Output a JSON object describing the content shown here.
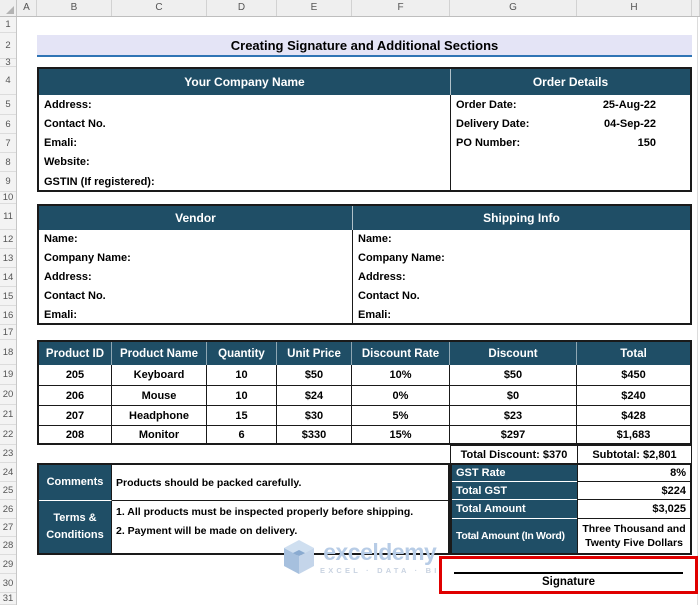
{
  "grid": {
    "columns": [
      "A",
      "B",
      "C",
      "D",
      "E",
      "F",
      "G",
      "H"
    ],
    "row_numbers": [
      "1",
      "2",
      "3",
      "4",
      "5",
      "6",
      "7",
      "8",
      "9",
      "10",
      "11",
      "12",
      "13",
      "14",
      "15",
      "16",
      "17",
      "18",
      "19",
      "20",
      "21",
      "22",
      "23",
      "24",
      "25",
      "26",
      "27",
      "28",
      "29",
      "30",
      "31"
    ]
  },
  "title": "Creating Signature and Additional Sections",
  "company": {
    "header": "Your Company Name",
    "fields": [
      "Address:",
      "Contact No.",
      "Emali:",
      "Website:",
      "GSTIN (If registered):"
    ]
  },
  "order_details": {
    "header": "Order Details",
    "rows": [
      {
        "label": "Order Date:",
        "value": "25-Aug-22"
      },
      {
        "label": "Delivery Date:",
        "value": "04-Sep-22"
      },
      {
        "label": "PO Number:",
        "value": "150"
      }
    ]
  },
  "vendor": {
    "header": "Vendor",
    "fields": [
      "Name:",
      "Company Name:",
      "Address:",
      "Contact No.",
      "Emali:"
    ]
  },
  "shipping": {
    "header": "Shipping Info",
    "fields": [
      "Name:",
      "Company Name:",
      "Address:",
      "Contact No.",
      "Emali:"
    ]
  },
  "products": {
    "headers": [
      "Product ID",
      "Product Name",
      "Quantity",
      "Unit Price",
      "Discount Rate",
      "Discount",
      "Total"
    ],
    "rows": [
      [
        "205",
        "Keyboard",
        "10",
        "$50",
        "10%",
        "$50",
        "$450"
      ],
      [
        "206",
        "Mouse",
        "10",
        "$24",
        "0%",
        "$0",
        "$240"
      ],
      [
        "207",
        "Headphone",
        "15",
        "$30",
        "5%",
        "$23",
        "$428"
      ],
      [
        "208",
        "Monitor",
        "6",
        "$330",
        "15%",
        "$297",
        "$1,683"
      ]
    ]
  },
  "totals": {
    "total_discount": "Total Discount: $370",
    "subtotal": "Subtotal: $2,801",
    "rows": [
      {
        "label": "GST Rate",
        "value": "8%"
      },
      {
        "label": "Total GST",
        "value": "$224"
      },
      {
        "label": "Total Amount",
        "value": "$3,025"
      }
    ],
    "in_word_label": "Total Amount (In Word)",
    "in_word_line1": "Three Thousand and",
    "in_word_line2": "Twenty Five Dollars"
  },
  "comments": {
    "label": "Comments",
    "text": "Products should be packed carefully."
  },
  "terms": {
    "label_line1": "Terms &",
    "label_line2": "Conditions",
    "line1": "1. All products must be inspected properly before shipping.",
    "line2": "2. Payment will be made on delivery."
  },
  "signature": {
    "label": "Signature"
  },
  "watermark": {
    "brand": "exceldemy",
    "tagline": "EXCEL · DATA · BI"
  },
  "colors": {
    "header-fill": "#1F4E66",
    "title-fill": "#E4E4F6",
    "title-underline": "#2F74B5",
    "highlight-red": "#E00000",
    "logo-blue": "#B7CCE6",
    "grid-border": "#1A1A1A"
  }
}
